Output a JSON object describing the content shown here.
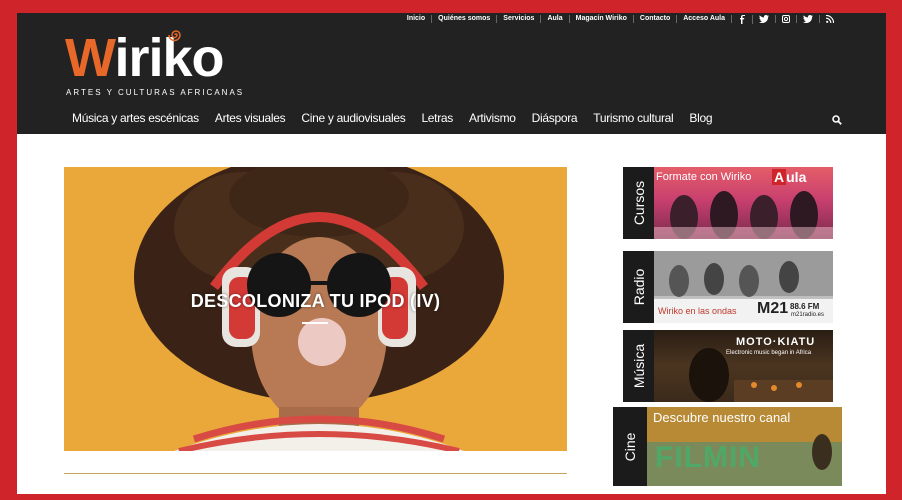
{
  "topnav": {
    "items": [
      "Inicio",
      "Quiénes somos",
      "Servicios",
      "Aula",
      "Magacín Wiriko",
      "Contacto",
      "Acceso Aula"
    ],
    "social_icons": [
      "facebook-icon",
      "twitter-icon",
      "instagram-icon",
      "twitter-icon",
      "rss-icon"
    ]
  },
  "logo": {
    "word_first": "W",
    "word_rest": "iriko",
    "tagline": "ARTES Y CULTURAS AFRICANAS"
  },
  "mainnav": {
    "items": [
      "Música y artes escénicas",
      "Artes visuales",
      "Cine y audiovisuales",
      "Letras",
      "Artivismo",
      "Diáspora",
      "Turismo cultural",
      "Blog"
    ]
  },
  "hero": {
    "title": "DESCOLONIZA TU IPOD (IV)"
  },
  "banners": {
    "cursos": {
      "side": "Cursos",
      "caption": "Formate con Wiriko",
      "brand_letter": "A",
      "brand_rest": "ula"
    },
    "radio": {
      "side": "Radio",
      "caption": "Wiriko en las ondas",
      "station": "M21",
      "freq": "88.6 FM",
      "site": "m21radio.es"
    },
    "musica": {
      "side": "Música",
      "title": "MOTO·KIATU",
      "subtitle": "Electronic music began in Africa"
    },
    "cine": {
      "side": "Cine",
      "caption": "Descubre nuestro canal",
      "brand": "FILMIN"
    }
  },
  "colors": {
    "frame": "#d0242b",
    "header": "#222222",
    "logo_accent": "#e8682a",
    "hero_bg": "#e9a83a"
  }
}
